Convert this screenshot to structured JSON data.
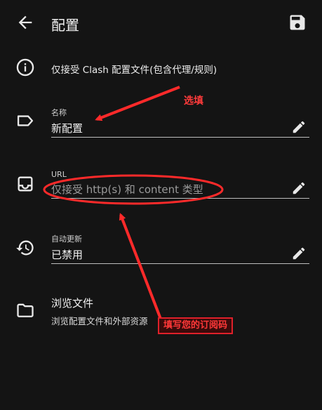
{
  "app_bar": {
    "title": "配置",
    "back_icon": "arrow-back-icon",
    "save_icon": "save-icon"
  },
  "info": {
    "icon": "info-icon",
    "text": "仅接受 Clash 配置文件(包含代理/规则)"
  },
  "fields": {
    "name": {
      "icon": "label-tag-icon",
      "label": "名称",
      "value": "新配置",
      "edit_icon": "pencil-icon"
    },
    "url": {
      "icon": "inbox-tray-icon",
      "label": "URL",
      "placeholder": "仅接受 http(s) 和 content 类型",
      "value": "",
      "edit_icon": "pencil-icon"
    },
    "auto_update": {
      "icon": "history-clock-icon",
      "label": "自动更新",
      "value": "已禁用",
      "edit_icon": "pencil-icon"
    }
  },
  "browse": {
    "icon": "folder-icon",
    "title": "浏览文件",
    "subtitle": "浏览配置文件和外部资源"
  },
  "annotations": {
    "optional_note": "选填",
    "subscription_note": "填写您的订阅码",
    "color": "#ff2a2a"
  },
  "colors": {
    "background": "#141414",
    "text": "#e6e6e6",
    "underline": "#bdbdbd",
    "annotation": "#ff2a2a"
  }
}
